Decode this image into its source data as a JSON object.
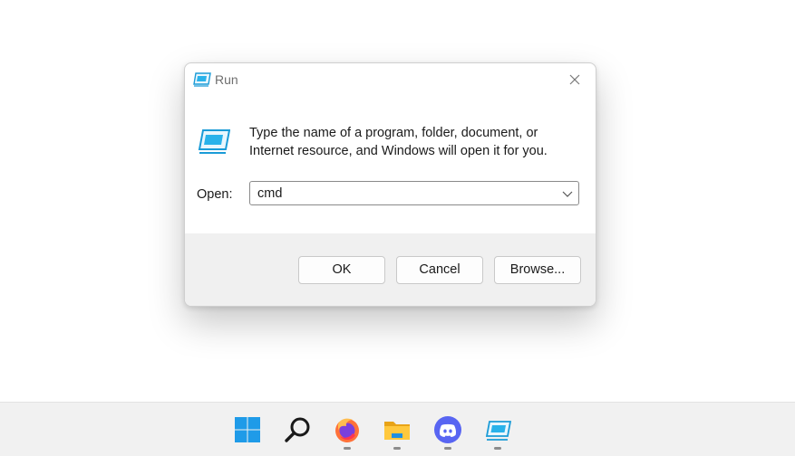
{
  "dialog": {
    "title": "Run",
    "description": "Type the name of a program, folder, document, or Internet resource, and Windows will open it for you.",
    "open_label": "Open:",
    "open_value": "cmd",
    "buttons": {
      "ok": "OK",
      "cancel": "Cancel",
      "browse": "Browse..."
    }
  },
  "taskbar": {
    "items": [
      {
        "name": "start",
        "icon": "windows-start-icon",
        "running": false
      },
      {
        "name": "search",
        "icon": "search-icon",
        "running": false
      },
      {
        "name": "firefox",
        "icon": "firefox-icon",
        "running": true
      },
      {
        "name": "file-explorer",
        "icon": "folder-icon",
        "running": true
      },
      {
        "name": "discord",
        "icon": "discord-icon",
        "running": true
      },
      {
        "name": "run",
        "icon": "run-icon",
        "running": true
      }
    ]
  },
  "colors": {
    "accent": "#0a84c9",
    "footer": "#f0f0f0",
    "taskbar": "#f1f1f1"
  }
}
